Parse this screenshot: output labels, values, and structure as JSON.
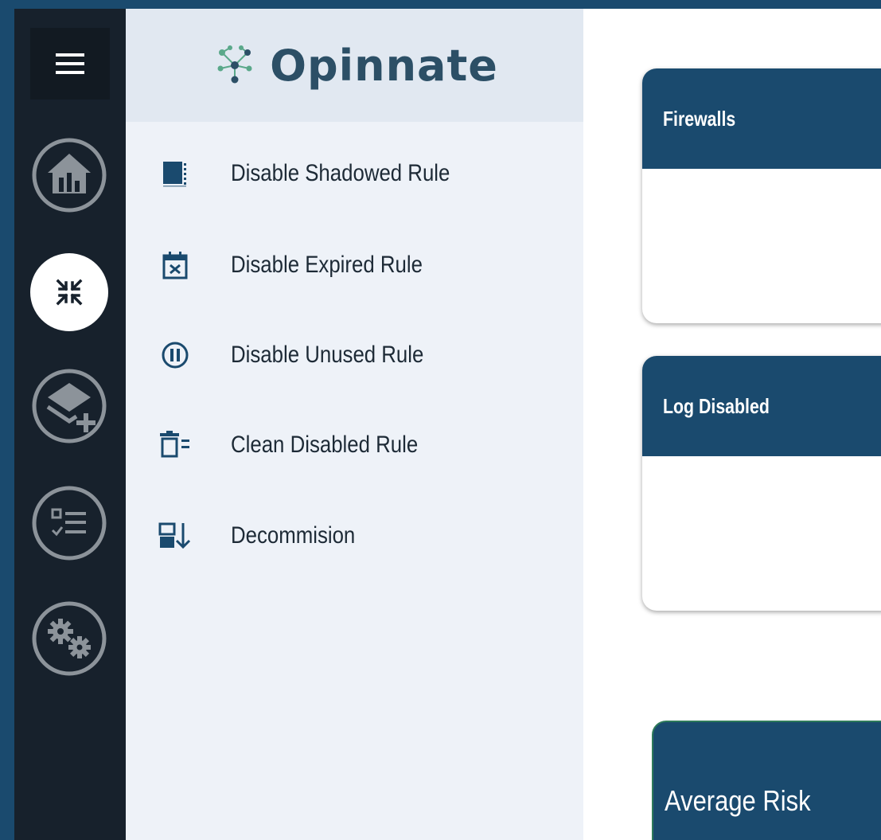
{
  "brand": {
    "name": "Opinnate",
    "logo_color": "#2c4f66",
    "accent_color": "#5aa88a"
  },
  "icon_nav": {
    "items": [
      {
        "icon": "hamburger-menu-icon",
        "active": false
      },
      {
        "icon": "home-icon",
        "active": false
      },
      {
        "icon": "collapse-arrows-icon",
        "active": true
      },
      {
        "icon": "layers-add-icon",
        "active": false
      },
      {
        "icon": "checklist-icon",
        "active": false
      },
      {
        "icon": "settings-gears-icon",
        "active": false
      }
    ]
  },
  "menu": {
    "items": [
      {
        "label": "Disable Shadowed Rule",
        "icon": "shadowed-rule-icon"
      },
      {
        "label": "Disable Expired Rule",
        "icon": "calendar-x-icon"
      },
      {
        "label": "Disable Unused Rule",
        "icon": "pause-circle-icon"
      },
      {
        "label": "Clean Disabled Rule",
        "icon": "trash-list-icon"
      },
      {
        "label": "Decommision",
        "icon": "decommission-icon"
      }
    ]
  },
  "cards": [
    {
      "title": "Firewalls"
    },
    {
      "title": "Log Disabled"
    }
  ],
  "risk_card": {
    "title": "Average Risk"
  },
  "colors": {
    "header_blue": "#1a4a6e",
    "sidebar_dark": "#17212c",
    "menu_bg": "#eef2f8",
    "logo_bg": "#e1e8f1"
  }
}
